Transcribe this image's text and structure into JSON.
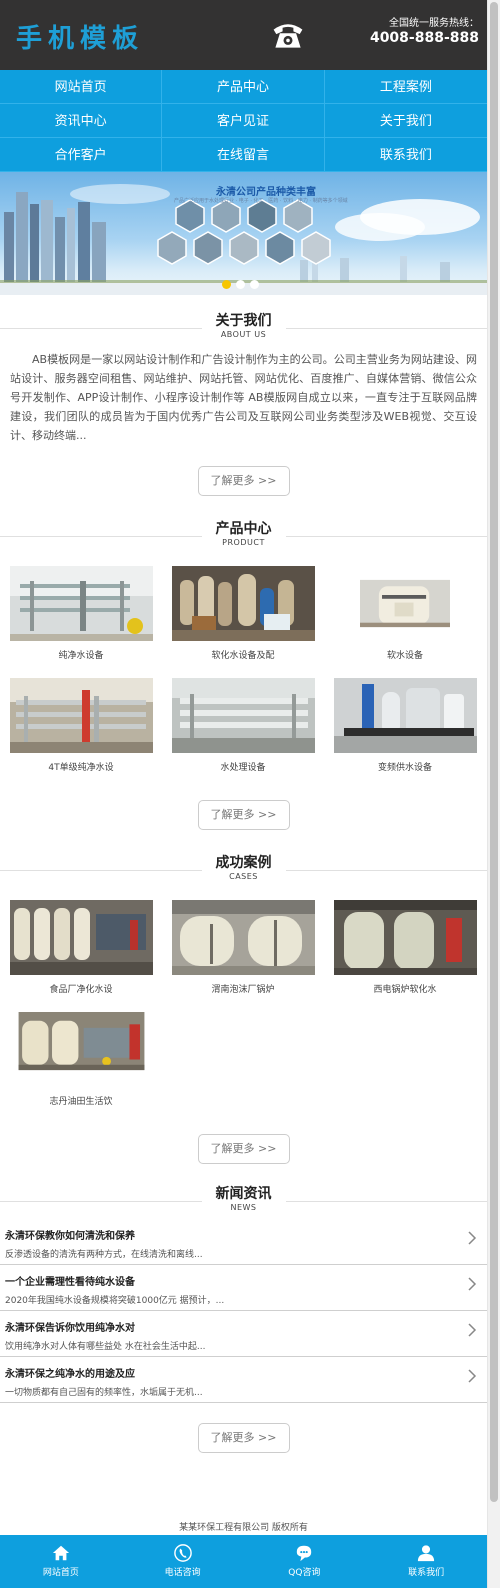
{
  "header": {
    "logo": "手机模板",
    "hotline_label": "全国统一服务热线：",
    "hotline_number": "4008-888-888"
  },
  "nav": [
    "网站首页",
    "产品中心",
    "工程案例",
    "资讯中心",
    "客户见证",
    "关于我们",
    "合作客户",
    "在线留言",
    "联系我们"
  ],
  "banner": {
    "title": "永清公司产品种类丰富",
    "subtitle": "产品广泛应用于水处理行业 · 电子 · 化工 · 医药 · 饮料 · 电力 · 制药等多个领域"
  },
  "about": {
    "title_cn": "关于我们",
    "title_en": "ABOUT US",
    "text": "AB模板网是一家以网站设计制作和广告设计制作为主的公司。公司主营业务为网站建设、网站设计、服务器空间租售、网站维护、网站托管、网站优化、百度推广、自媒体营销、微信公众号开发制作、APP设计制作、小程序设计制作等 AB模版网自成立以来，一直专注于互联网品牌建设，我们团队的成员皆为于国内优秀广告公司及互联网公司业务类型涉及WEB视觉、交互设计、移动终端...",
    "more": "了解更多 >>"
  },
  "products": {
    "title_cn": "产品中心",
    "title_en": "PRODUCT",
    "items": [
      "纯净水设备",
      "软化水设备及配",
      "软水设备",
      "4T单级纯净水设",
      "水处理设备",
      "变频供水设备"
    ],
    "more": "了解更多 >>"
  },
  "cases": {
    "title_cn": "成功案例",
    "title_en": "CASES",
    "items": [
      "食品厂净化水设",
      "渭南泡沫厂锅炉",
      "西电锅炉软化水",
      "志丹油田生活饮"
    ],
    "more": "了解更多 >>"
  },
  "news": {
    "title_cn": "新闻资讯",
    "title_en": "NEWS",
    "items": [
      {
        "title": "永清环保教你如何清洗和保养",
        "desc": "反渗透设备的清洗有两种方式，在线清洗和离线..."
      },
      {
        "title": "一个企业需理性看待纯水设备",
        "desc": "2020年我国纯水设备规模将突破1000亿元 据预计，..."
      },
      {
        "title": "永清环保告诉你饮用纯净水对",
        "desc": "饮用纯净水对人体有哪些益处 水在社会生活中起..."
      },
      {
        "title": "永清环保之纯净水的用途及应",
        "desc": "一切物质都有自己固有的频率性，水垢属于无机..."
      }
    ],
    "more": "了解更多 >>"
  },
  "footer": {
    "copyright": "某某环保工程有限公司 版权所有"
  },
  "bottom_bar": [
    {
      "label": "网站首页",
      "icon": "home-icon"
    },
    {
      "label": "电话咨询",
      "icon": "phone-icon"
    },
    {
      "label": "QQ咨询",
      "icon": "chat-icon"
    },
    {
      "label": "联系我们",
      "icon": "user-icon"
    }
  ],
  "colors": {
    "primary": "#0e9fde",
    "header_bg": "#333232",
    "logo": "#1e9fd6"
  }
}
